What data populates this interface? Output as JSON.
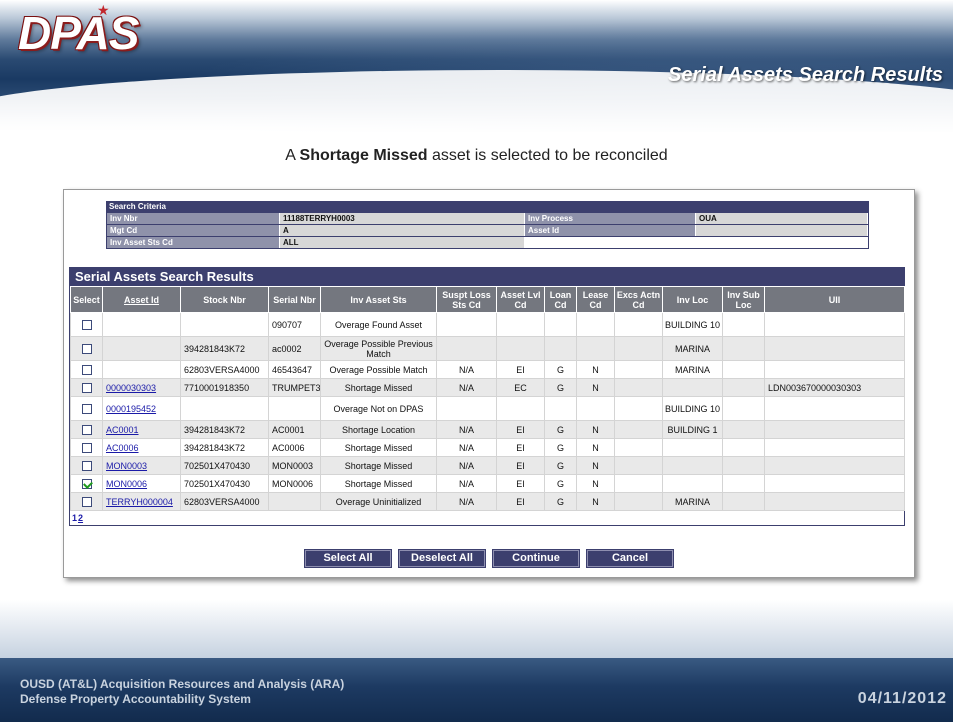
{
  "header": {
    "logo_text": "DPAS",
    "page_title": "Serial Assets Search Results"
  },
  "subtitle": {
    "prefix": "A ",
    "emphasis": "Shortage Missed",
    "suffix": " asset is selected to be reconciled"
  },
  "criteria": {
    "title": "Search Criteria",
    "inv_nbr_label": "Inv Nbr",
    "inv_nbr_value": "11188TERRYH0003",
    "inv_process_label": "Inv Process",
    "inv_process_value": "OUA",
    "mgt_cd_label": "Mgt Cd",
    "mgt_cd_value": "A",
    "asset_id_label": "Asset Id",
    "asset_id_value": "",
    "inv_asset_sts_label": "Inv Asset Sts Cd",
    "inv_asset_sts_value": "ALL"
  },
  "results": {
    "title": "Serial Assets Search Results",
    "columns": [
      "Select",
      "Asset Id",
      "Stock Nbr",
      "Serial Nbr",
      "Inv Asset Sts",
      "Suspt Loss Sts Cd",
      "Asset Lvl Cd",
      "Loan Cd",
      "Lease Cd",
      "Excs Actn Cd",
      "Inv Loc",
      "Inv Sub Loc",
      "UII"
    ],
    "rows": [
      {
        "checked": false,
        "asset_id": "",
        "stock_nbr": "",
        "serial_nbr": "090707",
        "inv_asset_sts": "Overage Found Asset",
        "suspt_loss": "",
        "asset_lvl": "",
        "loan": "",
        "lease": "",
        "excs": "",
        "inv_loc": "BUILDING 10",
        "inv_sub_loc": "",
        "uii": ""
      },
      {
        "checked": false,
        "asset_id": "",
        "stock_nbr": "394281843K72",
        "serial_nbr": "ac0002",
        "inv_asset_sts": "Overage Possible Previous Match",
        "suspt_loss": "",
        "asset_lvl": "",
        "loan": "",
        "lease": "",
        "excs": "",
        "inv_loc": "MARINA",
        "inv_sub_loc": "",
        "uii": ""
      },
      {
        "checked": false,
        "asset_id": "",
        "stock_nbr": "62803VERSA4000",
        "serial_nbr": "46543647",
        "inv_asset_sts": "Overage Possible Match",
        "suspt_loss": "N/A",
        "asset_lvl": "EI",
        "loan": "G",
        "lease": "N",
        "excs": "",
        "inv_loc": "MARINA",
        "inv_sub_loc": "",
        "uii": ""
      },
      {
        "checked": false,
        "asset_id": "0000030303",
        "stock_nbr": "7710001918350",
        "serial_nbr": "TRUMPET3",
        "inv_asset_sts": "Shortage Missed",
        "suspt_loss": "N/A",
        "asset_lvl": "EC",
        "loan": "G",
        "lease": "N",
        "excs": "",
        "inv_loc": "",
        "inv_sub_loc": "",
        "uii": "LDN003670000030303"
      },
      {
        "checked": false,
        "asset_id": "0000195452",
        "stock_nbr": "",
        "serial_nbr": "",
        "inv_asset_sts": "Overage Not on DPAS",
        "suspt_loss": "",
        "asset_lvl": "",
        "loan": "",
        "lease": "",
        "excs": "",
        "inv_loc": "BUILDING 10",
        "inv_sub_loc": "",
        "uii": ""
      },
      {
        "checked": false,
        "asset_id": "AC0001",
        "stock_nbr": "394281843K72",
        "serial_nbr": "AC0001",
        "inv_asset_sts": "Shortage Location",
        "suspt_loss": "N/A",
        "asset_lvl": "EI",
        "loan": "G",
        "lease": "N",
        "excs": "",
        "inv_loc": "BUILDING 1",
        "inv_sub_loc": "",
        "uii": ""
      },
      {
        "checked": false,
        "asset_id": "AC0006",
        "stock_nbr": "394281843K72",
        "serial_nbr": "AC0006",
        "inv_asset_sts": "Shortage Missed",
        "suspt_loss": "N/A",
        "asset_lvl": "EI",
        "loan": "G",
        "lease": "N",
        "excs": "",
        "inv_loc": "",
        "inv_sub_loc": "",
        "uii": ""
      },
      {
        "checked": false,
        "asset_id": "MON0003",
        "stock_nbr": "702501X470430",
        "serial_nbr": "MON0003",
        "inv_asset_sts": "Shortage Missed",
        "suspt_loss": "N/A",
        "asset_lvl": "EI",
        "loan": "G",
        "lease": "N",
        "excs": "",
        "inv_loc": "",
        "inv_sub_loc": "",
        "uii": ""
      },
      {
        "checked": true,
        "asset_id": "MON0006",
        "stock_nbr": "702501X470430",
        "serial_nbr": "MON0006",
        "inv_asset_sts": "Shortage Missed",
        "suspt_loss": "N/A",
        "asset_lvl": "EI",
        "loan": "G",
        "lease": "N",
        "excs": "",
        "inv_loc": "",
        "inv_sub_loc": "",
        "uii": ""
      },
      {
        "checked": false,
        "asset_id": "TERRYH000004",
        "stock_nbr": "62803VERSA4000",
        "serial_nbr": "",
        "inv_asset_sts": "Overage Uninitialized",
        "suspt_loss": "N/A",
        "asset_lvl": "EI",
        "loan": "G",
        "lease": "N",
        "excs": "",
        "inv_loc": "MARINA",
        "inv_sub_loc": "",
        "uii": ""
      }
    ],
    "pager": {
      "current": "1",
      "next": "2"
    }
  },
  "buttons": {
    "select_all": "Select All",
    "deselect_all": "Deselect All",
    "continue": "Continue",
    "cancel": "Cancel"
  },
  "footer": {
    "org_line1": "OUSD (AT&L) Acquisition Resources and Analysis (ARA)",
    "org_line2": "Defense Property Accountability System",
    "date": "04/11/2012"
  },
  "colors": {
    "navy": "#3c3f6e",
    "header_gray": "#74777f",
    "link_blue": "#1a1aa8",
    "logo_red": "#8a1c1c"
  }
}
